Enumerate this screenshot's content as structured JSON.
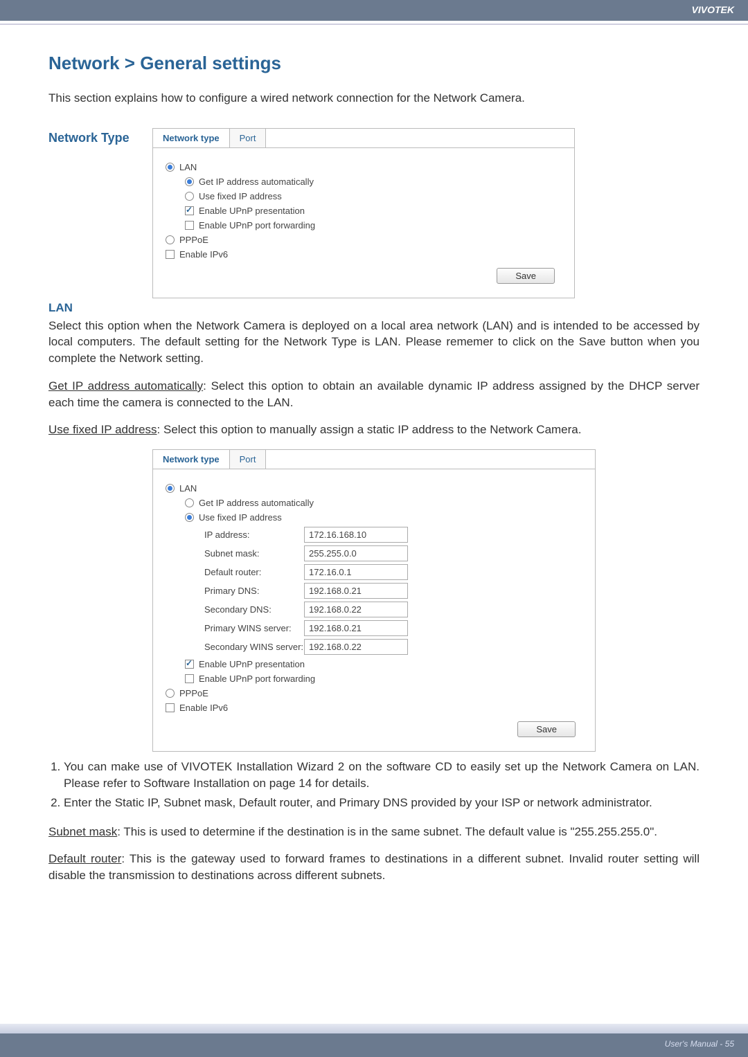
{
  "header": {
    "brand": "VIVOTEK"
  },
  "title": "Network > General settings",
  "intro": "This section explains how to configure a wired network connection for the Network Camera.",
  "network_type_label": "Network Type",
  "panel1": {
    "tabs": {
      "network_type": "Network type",
      "port": "Port"
    },
    "lan": "LAN",
    "get_ip": "Get IP address automatically",
    "use_fixed": "Use fixed IP address",
    "upnp_pres": "Enable UPnP presentation",
    "upnp_port": "Enable UPnP port forwarding",
    "pppoe": "PPPoE",
    "ipv6": "Enable IPv6",
    "save": "Save"
  },
  "lan_heading": "LAN",
  "lan_para": "Select this option when the Network Camera is deployed on a local area network (LAN) and is intended to be accessed by local computers. The default setting for the Network Type is LAN. Please rememer to click on the Save button when you complete the Network setting.",
  "getip_para_label": "Get IP address automatically",
  "getip_para_rest": ": Select this option to obtain an available dynamic IP address assigned by the DHCP server each time the camera is connected to the LAN.",
  "usefixed_para_label": "Use fixed IP address",
  "usefixed_para_rest": ": Select this option to manually assign a static IP address to the Network Camera.",
  "panel2": {
    "tabs": {
      "network_type": "Network type",
      "port": "Port"
    },
    "lan": "LAN",
    "get_ip": "Get IP address automatically",
    "use_fixed": "Use fixed IP address",
    "fields": {
      "ip_label": "IP address:",
      "ip_value": "172.16.168.10",
      "subnet_label": "Subnet mask:",
      "subnet_value": "255.255.0.0",
      "router_label": "Default router:",
      "router_value": "172.16.0.1",
      "pdns_label": "Primary DNS:",
      "pdns_value": "192.168.0.21",
      "sdns_label": "Secondary DNS:",
      "sdns_value": "192.168.0.22",
      "pwins_label": "Primary WINS server:",
      "pwins_value": "192.168.0.21",
      "swins_label": "Secondary WINS server:",
      "swins_value": "192.168.0.22"
    },
    "upnp_pres": "Enable UPnP presentation",
    "upnp_port": "Enable UPnP port forwarding",
    "pppoe": "PPPoE",
    "ipv6": "Enable IPv6",
    "save": "Save"
  },
  "notes": {
    "n1": "You can make use of VIVOTEK Installation Wizard 2 on the software CD to easily set up the Network Camera on LAN. Please refer to Software Installation on page 14 for details.",
    "n2": "Enter the Static IP, Subnet mask, Default router, and Primary DNS provided by your ISP or network administrator."
  },
  "subnet_label": "Subnet mask",
  "subnet_rest": ": This is used to determine if the destination is in the same subnet. The default value is \"255.255.255.0\".",
  "router_label": "Default router",
  "router_rest": ": This is the gateway used to forward frames to destinations in a different subnet. Invalid router setting will disable the transmission to destinations across different subnets.",
  "footer": {
    "page": "User's Manual - 55"
  }
}
